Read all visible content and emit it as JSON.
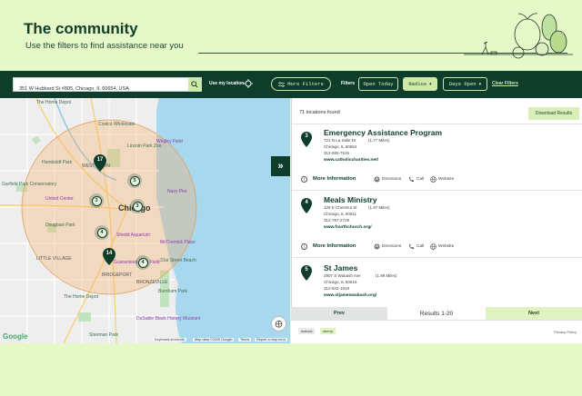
{
  "hero": {
    "title": "The community",
    "subtitle": "Use the filters to find assistance near you"
  },
  "filterbar": {
    "address_value": "351 W Hubbard St #805, Chicago, IL 60654, USA",
    "use_location_label": "Use my location",
    "more_filters_label": "More Filters",
    "filters_label": "Filters",
    "open_today_label": "Open Today",
    "radius_label": "Radius",
    "days_open_label": "Days Open",
    "clear_filters_label": "Clear Filters"
  },
  "results": {
    "count_text": "71 locations found",
    "download_label": "Download Results",
    "more_info_label": "More Information",
    "directions_label": "Directions",
    "call_label": "Call",
    "website_label": "Website",
    "locations": [
      {
        "number": "3",
        "name": "Emergency Assistance Program",
        "street": "721 N La Salle Dr",
        "distance": "(1.77 Miles)",
        "city": "Chicago, IL 60654",
        "phone": "312-655-7516",
        "website": "www.catholiccharities.net/"
      },
      {
        "number": "4",
        "name": "Meals Ministry",
        "street": "126 E Chestnut St",
        "distance": "(1.97 Miles)",
        "city": "Chicago, IL 60611",
        "phone": "312-787-2729",
        "website": "www.fourthchurch.org/"
      },
      {
        "number": "5",
        "name": "St James",
        "street": "2907 S Wabash Ave",
        "distance": "(1.99 Miles)",
        "city": "Chicago, IL 60616",
        "phone": "312-842-1919",
        "website": "www.stjameswabash.org/"
      }
    ]
  },
  "pager": {
    "prev_label": "Prev",
    "results_label": "Results 1-20",
    "next_label": "Next"
  },
  "footer": {
    "logo_a": "instock",
    "logo_b": "sherry",
    "privacy": "Privacy Policy"
  },
  "map": {
    "city_label": "Chicago",
    "labels": {
      "home_depot_1": "The Home Depot",
      "costco": "Costco Wholesale",
      "lincoln_park_zoo": "Lincoln Park Zoo",
      "wrigley": "Wrigley Field",
      "humboldt": "Humboldt Park",
      "garfield": "Garfield Park Conservatory",
      "united_center": "United Center",
      "douglass": "Douglass Park",
      "shedd": "Shedd Aquarium",
      "mccormick": "McCormick Place",
      "guaranteed": "Guaranteed Rate Field",
      "bridgeport": "BRIDGEPORT",
      "home_depot_2": "The Home Depot",
      "dusable": "DuSable Black History Museum",
      "burnham": "Burnham Park",
      "navy": "Navy Pier",
      "sherman": "Sherman Park",
      "little_village": "LITTLE VILLAGE",
      "west_town": "WEST TOWN",
      "bronzeville": "BRONZEVILLE",
      "ts_park": "31st Street Beach"
    },
    "keyboard": "Keyboard shortcuts",
    "map_data": "Map data ©2025 Google",
    "terms": "Terms",
    "report": "Report a map error",
    "google": "Google",
    "clusters": [
      "3",
      "5",
      "4",
      "4",
      "3"
    ],
    "pins": [
      "17",
      "14",
      "3",
      "4",
      "5"
    ]
  },
  "colors": {
    "brand_dark": "#0f3d2b",
    "brand_light": "#cfe9a7",
    "page_bg": "#e6f7c8",
    "water": "#a8d8ee"
  }
}
